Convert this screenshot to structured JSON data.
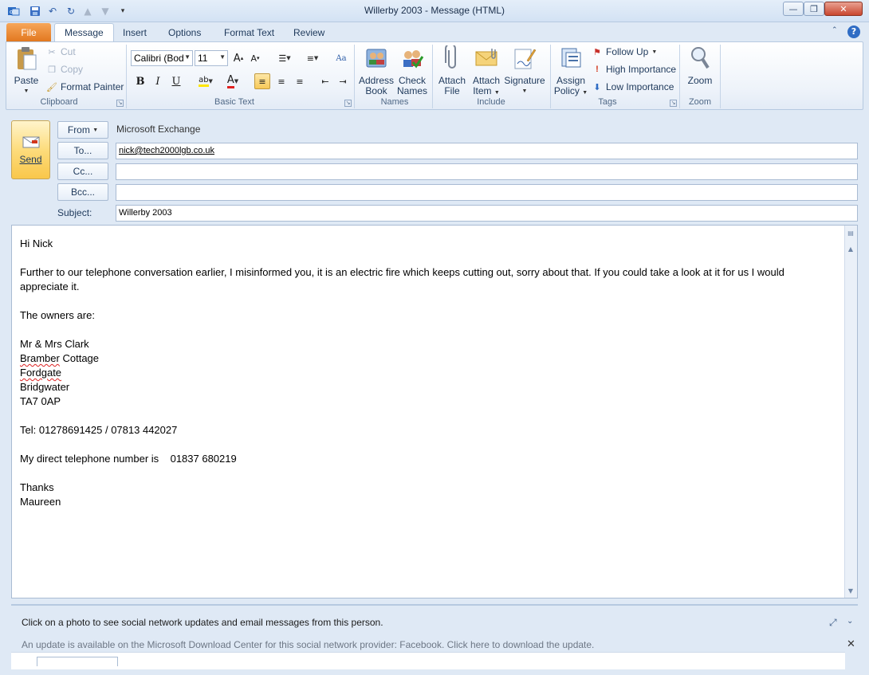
{
  "window": {
    "title": "Willerby 2003  -  Message (HTML)"
  },
  "tabs": [
    {
      "label": "File"
    },
    {
      "label": "Message"
    },
    {
      "label": "Insert"
    },
    {
      "label": "Options"
    },
    {
      "label": "Format Text"
    },
    {
      "label": "Review"
    }
  ],
  "ribbon": {
    "clipboard": {
      "label": "Clipboard",
      "paste": "Paste",
      "cut": "Cut",
      "copy": "Copy",
      "format_painter": "Format Painter"
    },
    "basic_text": {
      "label": "Basic Text",
      "font_name": "Calibri (Bod",
      "font_size": "11"
    },
    "names": {
      "label": "Names",
      "address_book_1": "Address",
      "address_book_2": "Book",
      "check_names_1": "Check",
      "check_names_2": "Names"
    },
    "include": {
      "label": "Include",
      "attach_file_1": "Attach",
      "attach_file_2": "File",
      "attach_item_1": "Attach",
      "attach_item_2": "Item",
      "signature": "Signature"
    },
    "tags": {
      "label": "Tags",
      "assign_policy_1": "Assign",
      "assign_policy_2": "Policy",
      "follow_up": "Follow Up",
      "high_importance": "High Importance",
      "low_importance": "Low Importance"
    },
    "zoom": {
      "label": "Zoom",
      "zoom": "Zoom"
    }
  },
  "header": {
    "send": "Send",
    "from_btn": "From",
    "from_value": "Microsoft Exchange",
    "to_btn": "To...",
    "to_value": "nick@tech2000lgb.co.uk",
    "cc_btn": "Cc...",
    "cc_value": "",
    "bcc_btn": "Bcc...",
    "bcc_value": "",
    "subject_label": "Subject:",
    "subject_value": "Willerby 2003"
  },
  "body": {
    "greeting": "Hi Nick",
    "para1": "Further to our telephone conversation earlier, I misinformed you, it is an electric fire which keeps cutting out, sorry about that.  If you could take a look at it for us I would appreciate it.",
    "owners_intro": "The owners are:",
    "owner_name": "Mr & Mrs Clark",
    "address_word1": "Bramber",
    "address_word2": " Cottage",
    "address2": "Fordgate",
    "address3": "Bridgwater",
    "postcode": "TA7 0AP",
    "tel": "Tel: 01278691425 / 07813 442027",
    "direct": "My direct telephone number is    01837 680219",
    "thanks": "Thanks",
    "signoff": "Maureen"
  },
  "social": {
    "hint": "Click on a photo to see social network updates and email messages from this person.",
    "update": "An update is available on the Microsoft Download Center for this social network provider: Facebook. Click here to download the update."
  },
  "colors": {
    "accent_file_tab": "#e2781f",
    "ribbon_border": "#b6c9e0",
    "send_button": "#f9c74a"
  }
}
